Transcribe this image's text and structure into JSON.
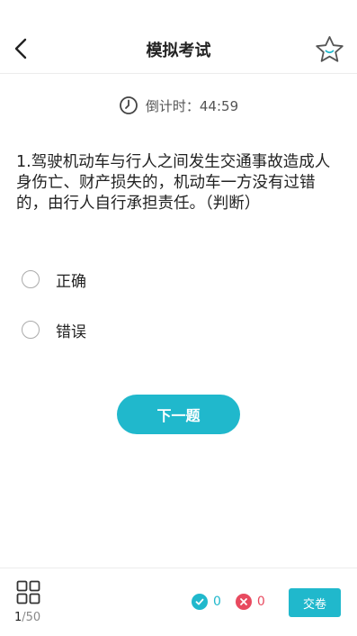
{
  "header": {
    "title": "模拟考试",
    "back_icon": "back-arrow-icon",
    "favorite_icon": "star-icon"
  },
  "timer": {
    "label": "倒计时：",
    "value": "44:59",
    "icon": "clock-icon"
  },
  "question": {
    "text": "1.驾驶机动车与行人之间发生交通事故造成人身伤亡、财产损失的，机动车一方没有过错的，由行人自行承担责任。（判断）",
    "options": [
      {
        "label": "正确"
      },
      {
        "label": "错误"
      }
    ]
  },
  "next_button": {
    "label": "下一题"
  },
  "footer": {
    "current": "1",
    "total": "/50",
    "correct_count": "0",
    "wrong_count": "0",
    "submit_label": "交卷",
    "grid_icon": "grid-icon"
  },
  "colors": {
    "accent": "#20b8cc",
    "wrong": "#e84a5f"
  }
}
